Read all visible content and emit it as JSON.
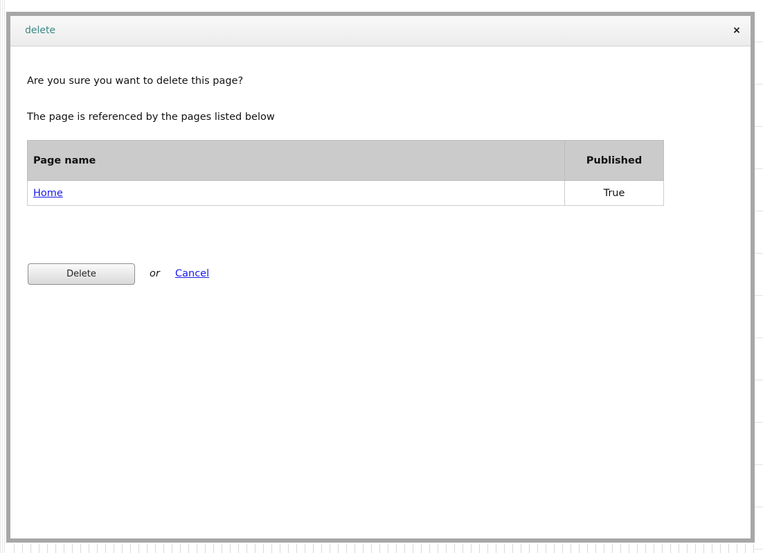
{
  "dialog": {
    "title": "delete",
    "close_icon": "close-icon",
    "close_glyph": "×",
    "title_color": "#3a8a86"
  },
  "messages": {
    "confirm": "Are you sure you want to delete this page?",
    "referenced": "The page is referenced by the pages listed below"
  },
  "table": {
    "headers": [
      "Page name",
      "Published"
    ],
    "rows": [
      {
        "page_name": "Home",
        "published": "True"
      }
    ]
  },
  "actions": {
    "delete_label": "Delete",
    "or_text": "or",
    "cancel_label": "Cancel",
    "link_color": "#1a1aee"
  }
}
